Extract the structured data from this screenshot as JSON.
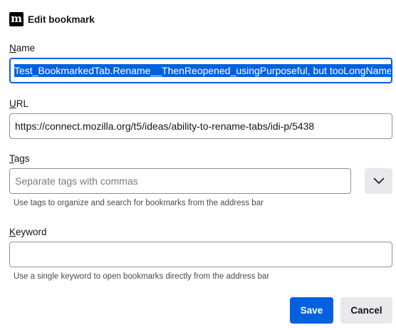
{
  "dialog": {
    "site_icon_letter": "m",
    "title": "Edit bookmark"
  },
  "name": {
    "label_access": "N",
    "label_rest": "ame",
    "value": "Test_BookmarkedTab.Rename__ThenReopened_usingPurposeful, but tooLongName"
  },
  "url": {
    "label_access": "U",
    "label_rest": "RL",
    "value": "https://connect.mozilla.org/t5/ideas/ability-to-rename-tabs/idi-p/5438"
  },
  "tags": {
    "label_access": "T",
    "label_rest": "ags",
    "placeholder": "Separate tags with commas",
    "value": "",
    "helper": "Use tags to organize and search for bookmarks from the address bar",
    "dropdown_icon": "chevron-down-icon"
  },
  "keyword": {
    "label_access": "K",
    "label_rest": "eyword",
    "value": "",
    "helper": "Use a single keyword to open bookmarks directly from the address bar"
  },
  "buttons": {
    "save": "Save",
    "cancel": "Cancel"
  },
  "colors": {
    "accent": "#0061e0",
    "button_secondary": "#e9e9ed",
    "text": "#15141a"
  }
}
